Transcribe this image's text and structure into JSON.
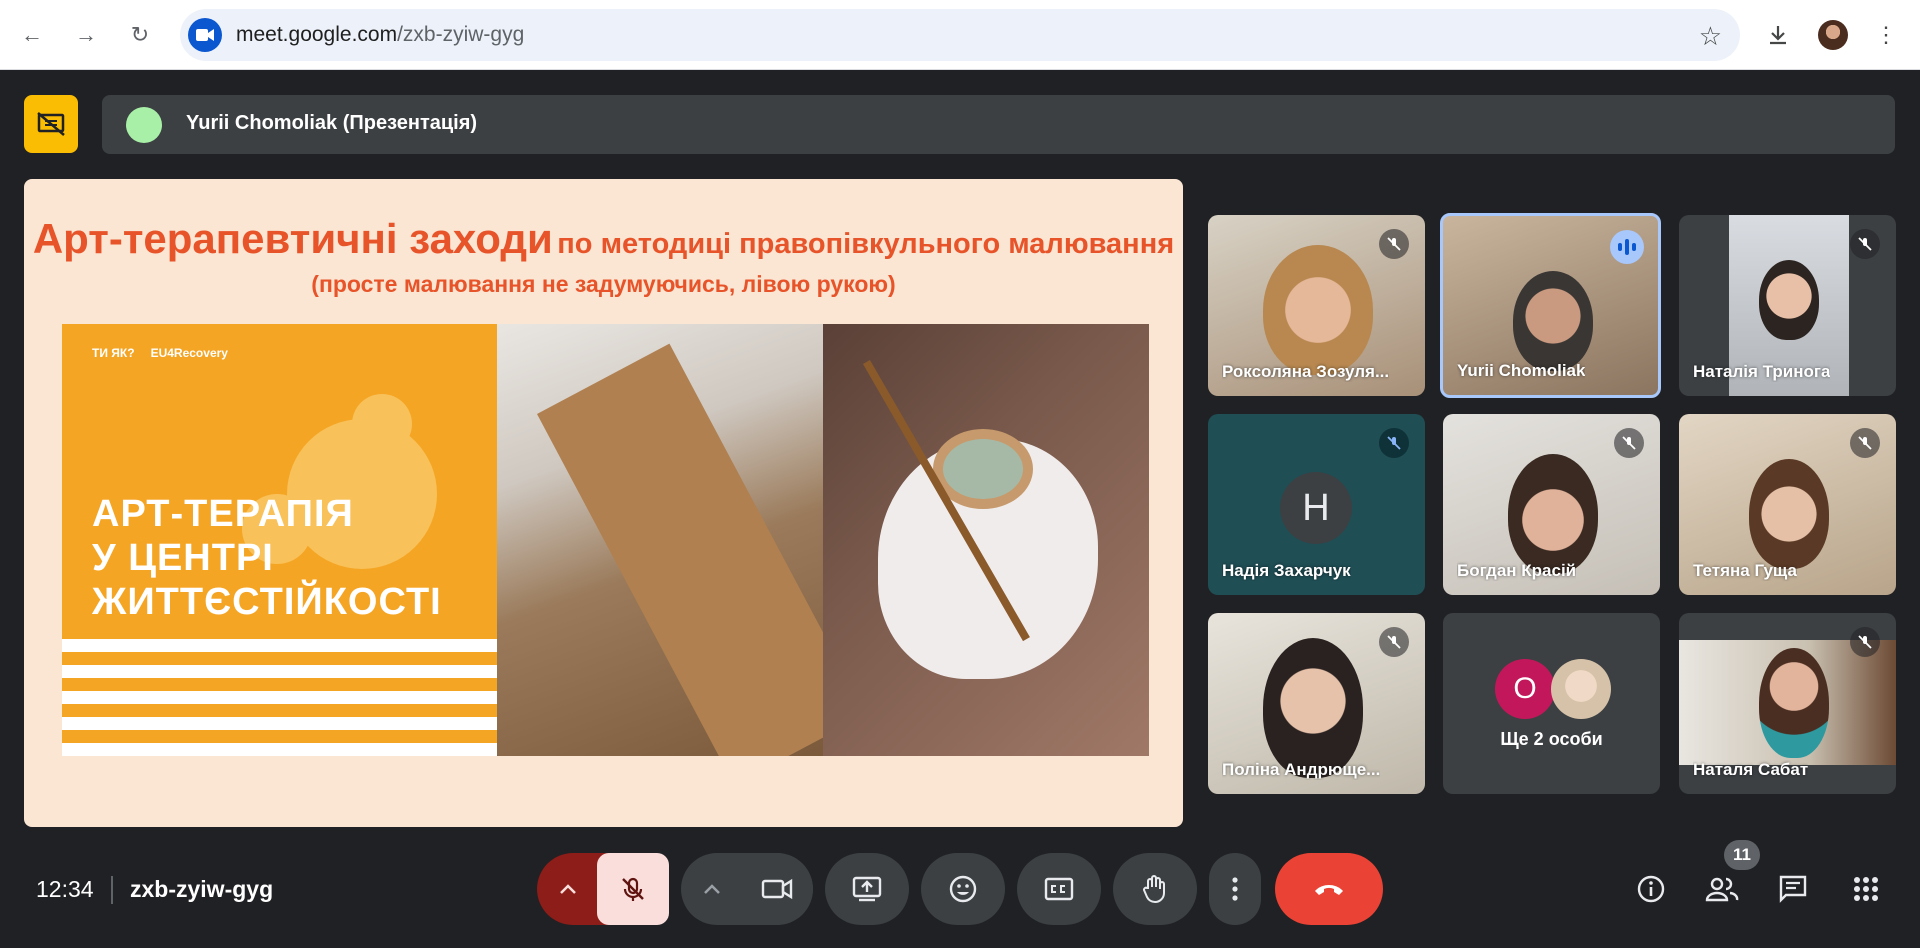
{
  "browser": {
    "url_host": "meet.google.com",
    "url_path": "/zxb-zyiw-gyg"
  },
  "presenter": {
    "label": "Yurii Chomoliak (Презентація)"
  },
  "slide": {
    "title_big": "Арт-терапевтичні заходи",
    "title_small": "по методиці правопівкульного малювання",
    "subtitle": "(просте малювання не задумуючись, лівою рукою)",
    "logos": [
      "ТИ ЯК?",
      "EU4Recovery"
    ],
    "art_title_lines": [
      "АРТ-ТЕРАПІЯ",
      "У ЦЕНТРІ",
      "ЖИТТЄСТІЙКОСТІ"
    ]
  },
  "participants": [
    {
      "name": "Роксоляна Зозуля...",
      "muted": true
    },
    {
      "name": "Yurii Chomoliak",
      "muted": false,
      "speaking": true
    },
    {
      "name": "Наталія Триногa",
      "muted": true
    },
    {
      "name": "Надія Захарчук",
      "muted": true,
      "initial": "Н"
    },
    {
      "name": "Богдан Красій",
      "muted": true
    },
    {
      "name": "Тетяна Гуща",
      "muted": true
    },
    {
      "name": "Поліна Андрюще...",
      "muted": true
    },
    {
      "name": "Ще 2 особи",
      "initial": "О"
    },
    {
      "name": "Наталя Сабат",
      "muted": true
    }
  ],
  "bottom_bar": {
    "time": "12:34",
    "meeting_code": "zxb-zyiw-gyg",
    "participant_count": "11"
  },
  "colors": {
    "background": "#202124",
    "tile": "#3c4043",
    "accent_yellow": "#fbbc04",
    "end_call": "#ea4335",
    "slide_title": "#e8542a"
  }
}
